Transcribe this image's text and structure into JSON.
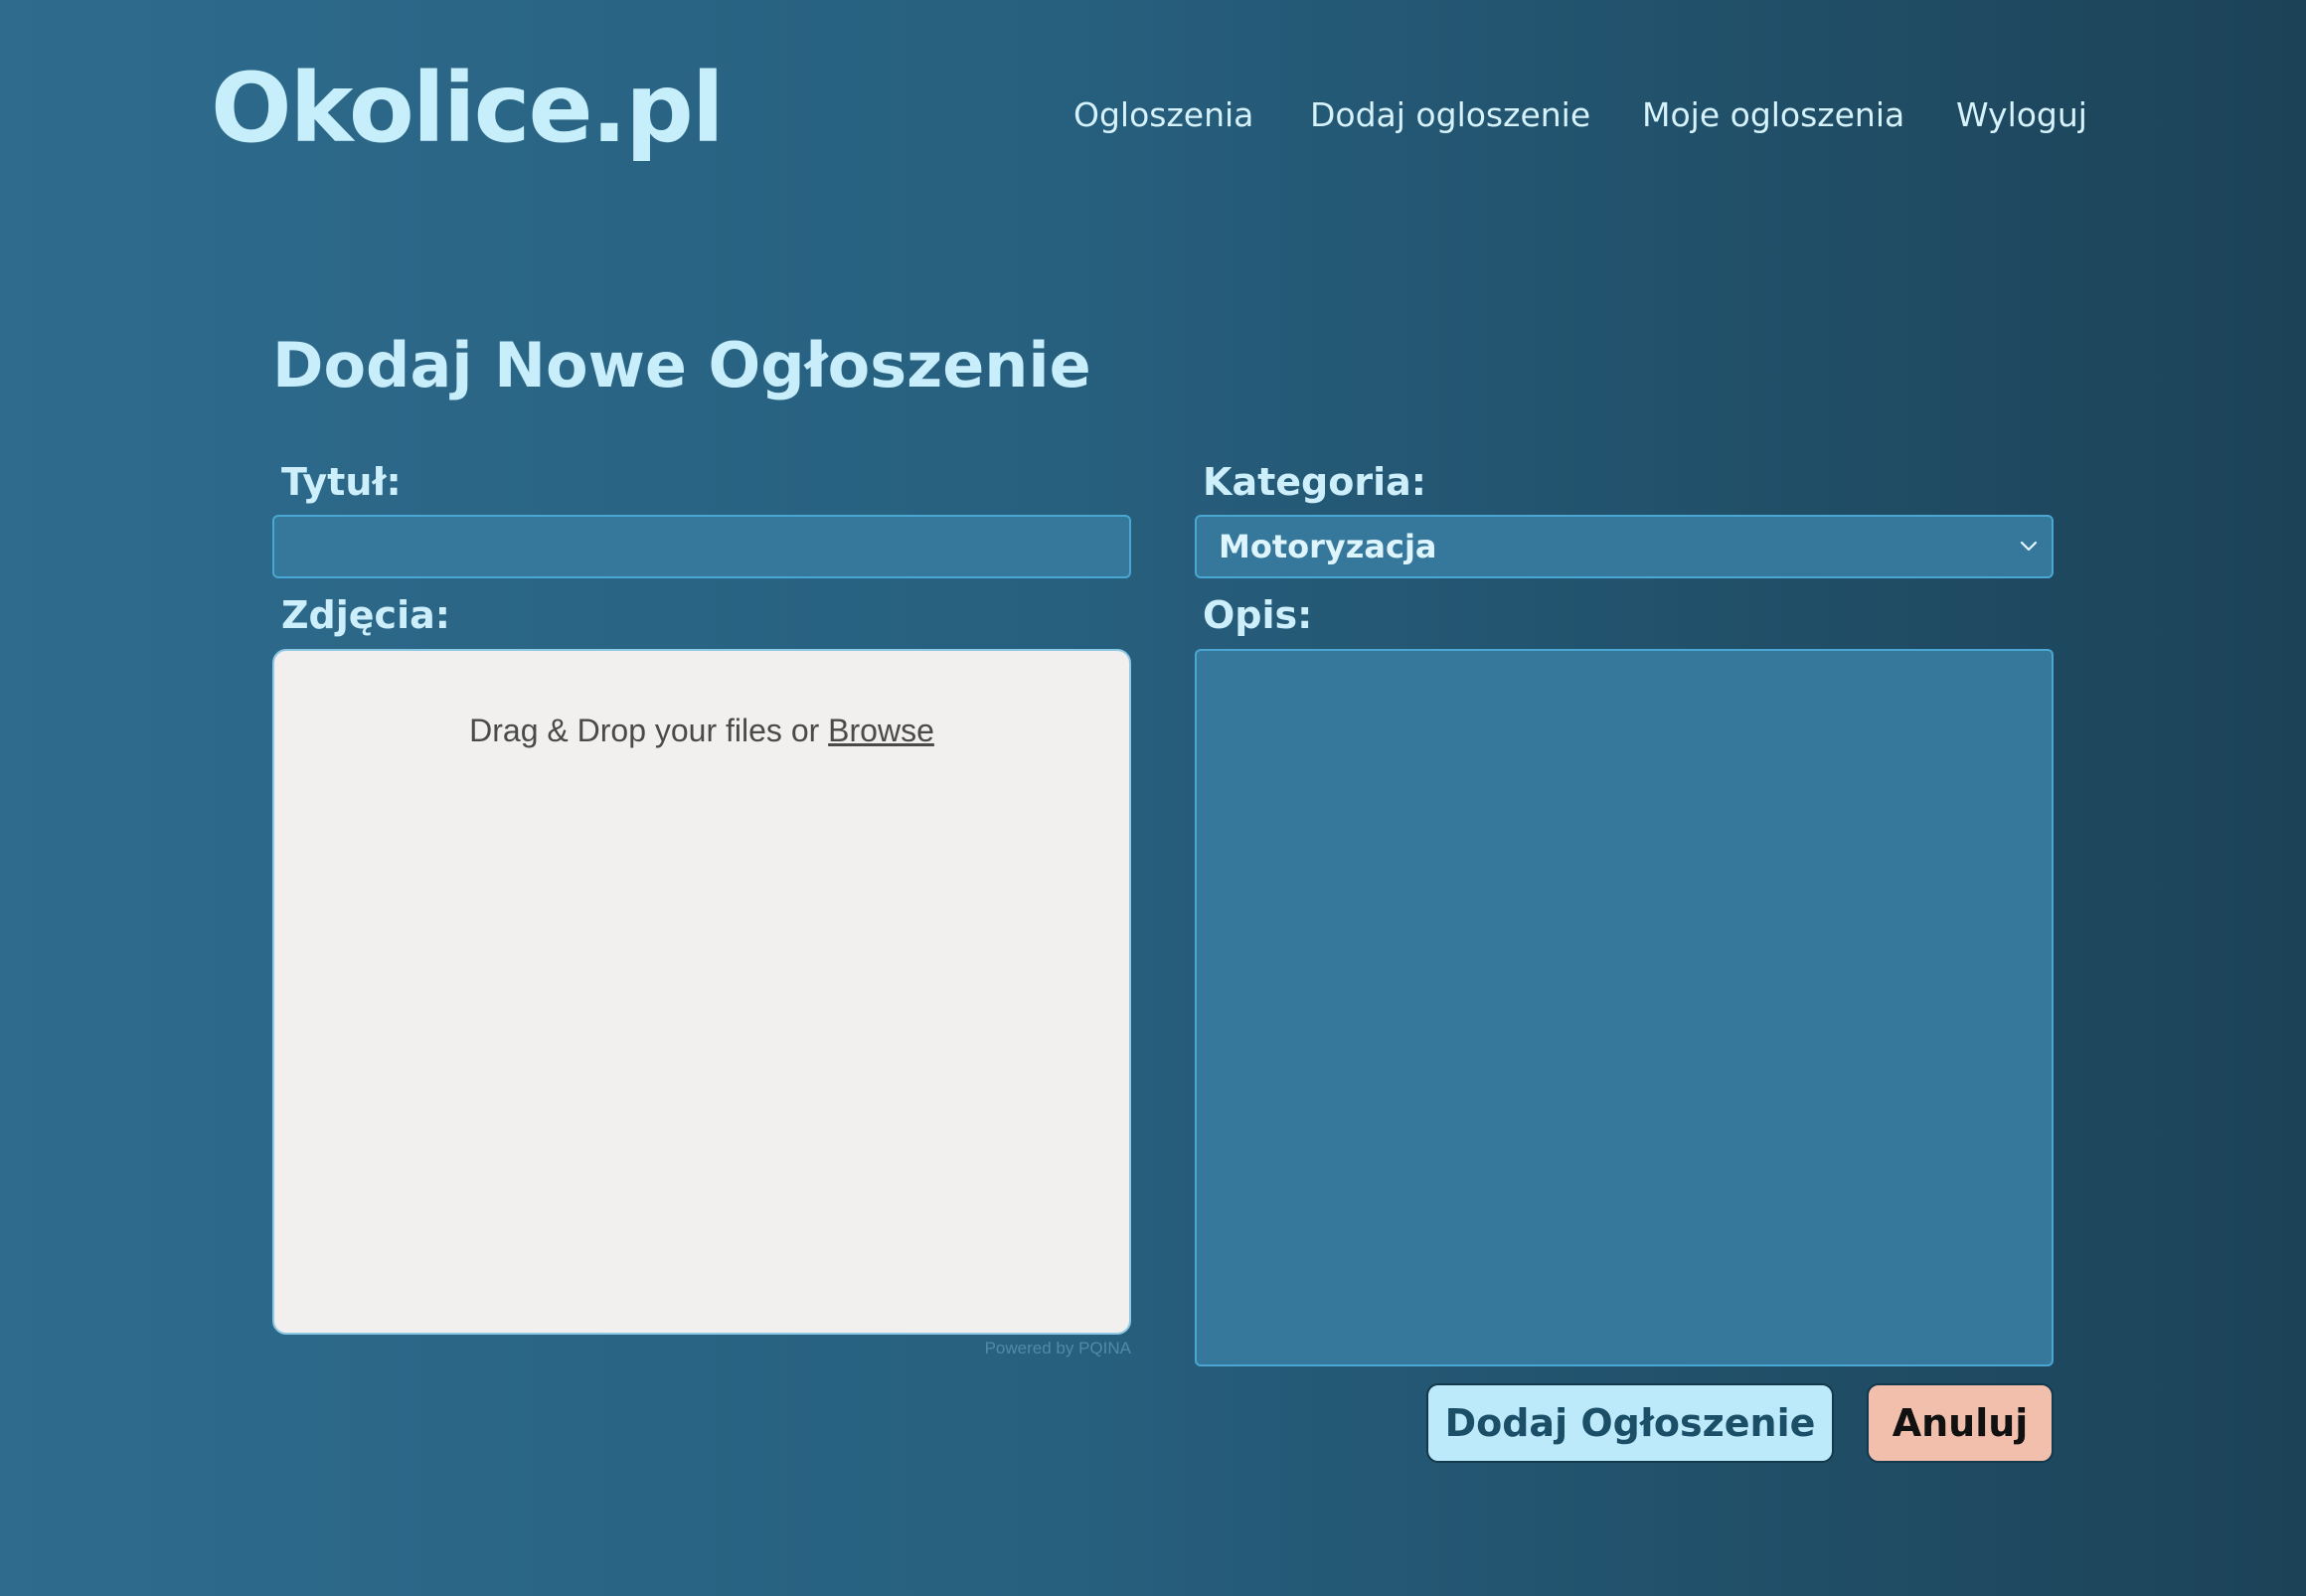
{
  "header": {
    "logo": "Okolice.pl",
    "nav": [
      "Ogloszenia",
      "Dodaj ogloszenie",
      "Moje ogloszenia",
      "Wyloguj"
    ]
  },
  "form": {
    "title": "Dodaj Nowe Ogłoszenie",
    "fields": {
      "title_label": "Tytuł:",
      "title_value": "",
      "category_label": "Kategoria:",
      "category_value": "Motoryzacja",
      "photos_label": "Zdjęcia:",
      "description_label": "Opis:",
      "description_value": ""
    },
    "dropzone": {
      "text": "Drag & Drop your files or ",
      "browse": "Browse",
      "powered": "Powered by PQINA"
    },
    "buttons": {
      "submit": "Dodaj Ogłoszenie",
      "cancel": "Anuluj"
    }
  },
  "colors": {
    "background_left": "#2e6b8d",
    "background_right": "#1c4257",
    "field_fill": "#35789c",
    "submit_button": "#bdeafb",
    "cancel_button": "#f3bfad"
  },
  "icons": {
    "category_select": "chevron-down-icon"
  }
}
